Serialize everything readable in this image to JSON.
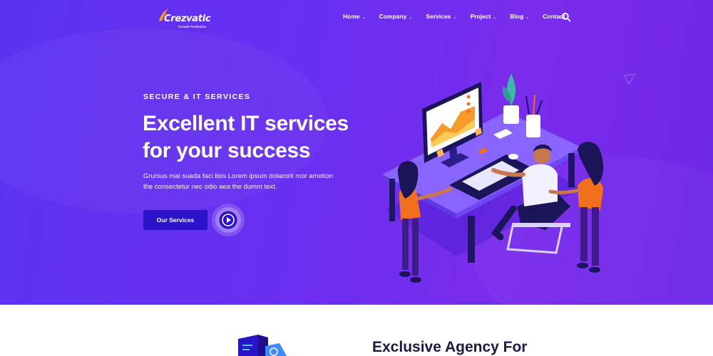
{
  "brand": {
    "name": "Crezvatic",
    "tagline": "Growth Prediction",
    "icon": "rocket-swoosh-logo"
  },
  "nav": {
    "items": [
      {
        "label": "Home",
        "has_dropdown": true
      },
      {
        "label": "Company",
        "has_dropdown": true
      },
      {
        "label": "Services",
        "has_dropdown": true
      },
      {
        "label": "Project",
        "has_dropdown": true
      },
      {
        "label": "Blog",
        "has_dropdown": true
      },
      {
        "label": "Contact",
        "has_dropdown": false
      }
    ],
    "search_icon": "search-icon"
  },
  "hero": {
    "eyebrow": "SECURE & IT SERVICES",
    "headline_line1": "Excellent IT services",
    "headline_line2": "for your success",
    "description_line1": "Grursus mal suada faci lisis Lorem ipsum dolarorit mor ametion",
    "description_line2": "the consectetur nec odio aea the dumm text.",
    "cta_label": "Our Services",
    "play_icon": "play-icon"
  },
  "next_section": {
    "title": "Exclusive Agency For"
  },
  "colors": {
    "hero_gradient_start": "#5b32f0",
    "hero_gradient_end": "#7a2cec",
    "cta_background": "#2a13c9",
    "accent_orange": "#f2701d",
    "heading_dark": "#1c1947"
  }
}
